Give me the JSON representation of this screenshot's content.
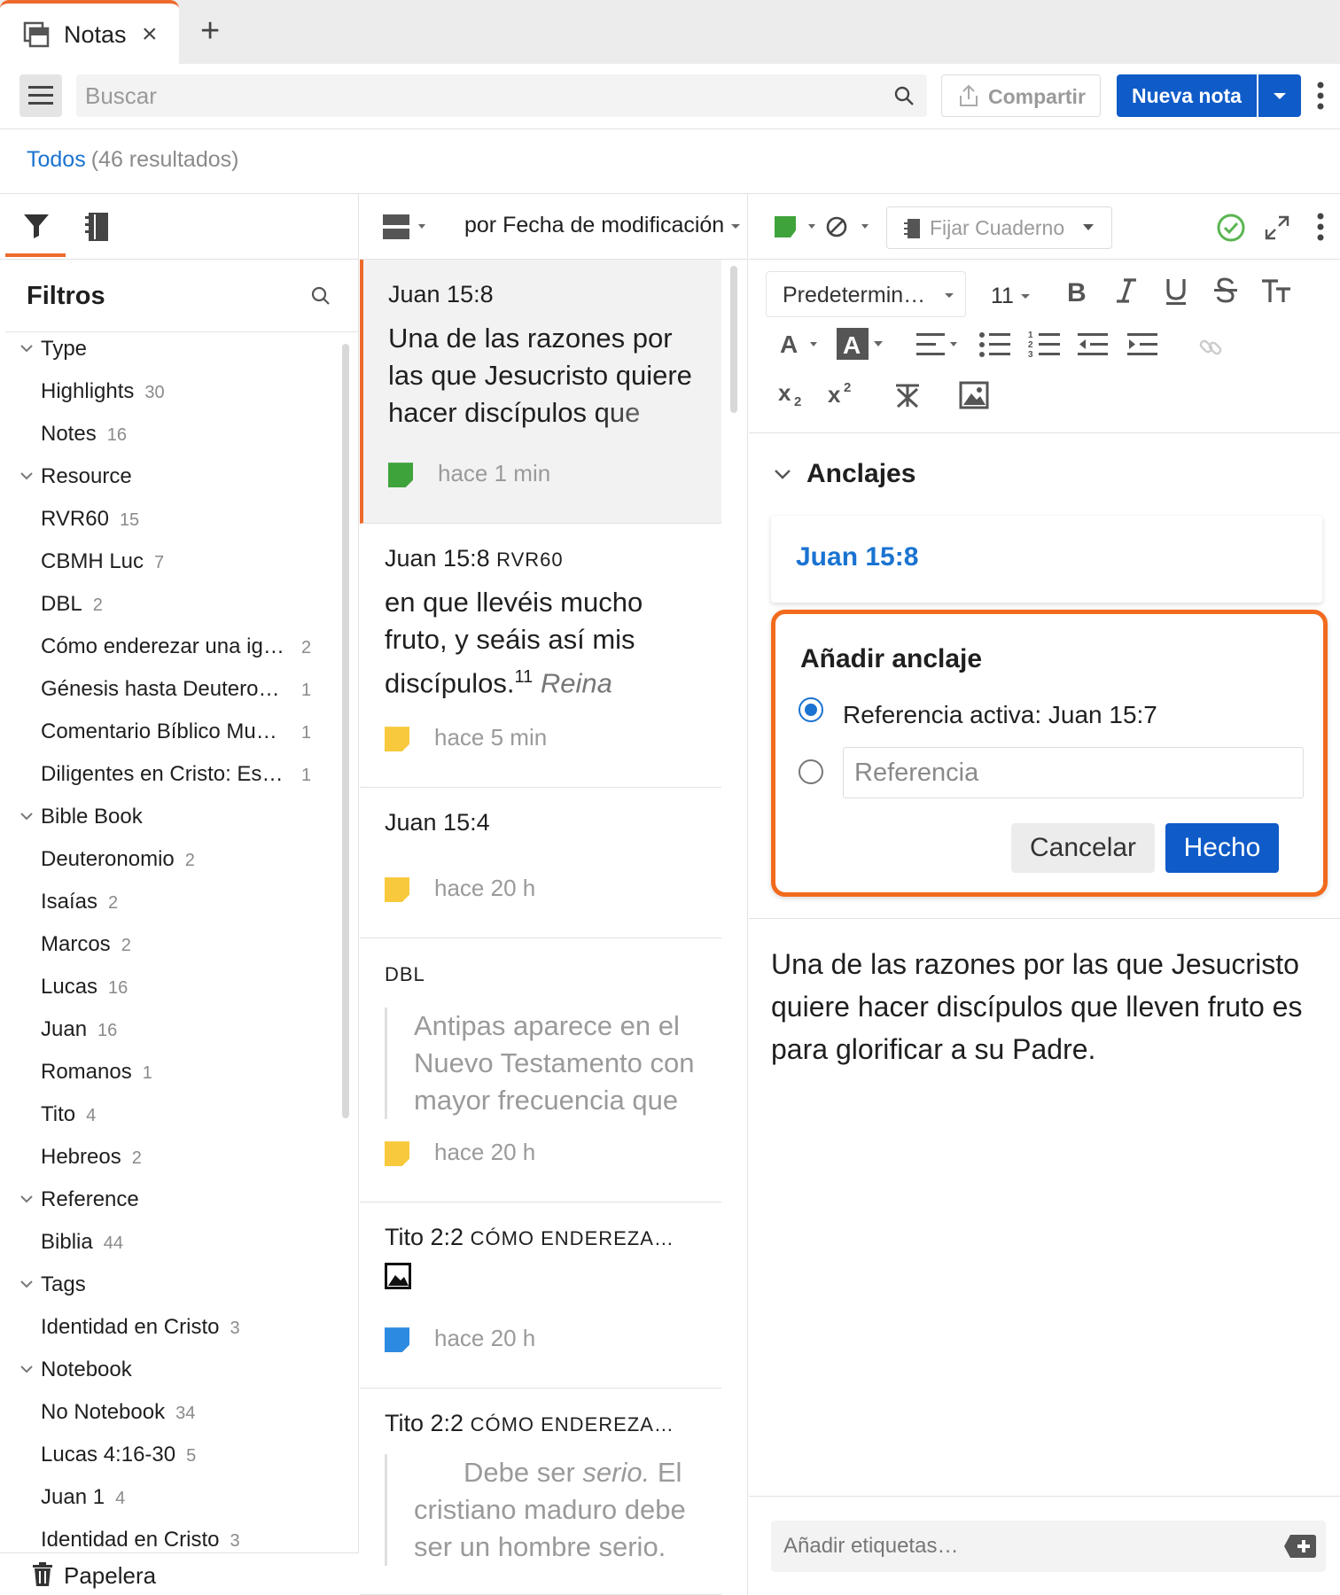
{
  "tab": {
    "title": "Notas",
    "close_icon": "×",
    "add_icon": "+"
  },
  "toolbar": {
    "search_placeholder": "Buscar",
    "share_label": "Compartir",
    "new_note_label": "Nueva nota"
  },
  "results": {
    "filter_label": "Todos",
    "count_label": "(46 resultados)"
  },
  "filters": {
    "title": "Filtros",
    "groups": [
      {
        "label": "Type",
        "items": [
          {
            "label": "Highlights",
            "count": "30"
          },
          {
            "label": "Notes",
            "count": "16"
          }
        ]
      },
      {
        "label": "Resource",
        "items": [
          {
            "label": "RVR60",
            "count": "15"
          },
          {
            "label": "CBMH Luc",
            "count": "7"
          },
          {
            "label": "DBL",
            "count": "2"
          },
          {
            "label": "Cómo enderezar una ig…",
            "count": "2"
          },
          {
            "label": "Génesis hasta Deutero…",
            "count": "1"
          },
          {
            "label": "Comentario Bíblico Mu…",
            "count": "1"
          },
          {
            "label": "Diligentes en Cristo: Est…",
            "count": "1"
          }
        ]
      },
      {
        "label": "Bible Book",
        "items": [
          {
            "label": "Deuteronomio",
            "count": "2"
          },
          {
            "label": "Isaías",
            "count": "2"
          },
          {
            "label": "Marcos",
            "count": "2"
          },
          {
            "label": "Lucas",
            "count": "16"
          },
          {
            "label": "Juan",
            "count": "16"
          },
          {
            "label": "Romanos",
            "count": "1"
          },
          {
            "label": "Tito",
            "count": "4"
          },
          {
            "label": "Hebreos",
            "count": "2"
          }
        ]
      },
      {
        "label": "Reference",
        "items": [
          {
            "label": "Biblia",
            "count": "44"
          }
        ]
      },
      {
        "label": "Tags",
        "items": [
          {
            "label": "Identidad en Cristo",
            "count": "3"
          }
        ]
      },
      {
        "label": "Notebook",
        "items": [
          {
            "label": "No Notebook",
            "count": "34"
          },
          {
            "label": "Lucas 4:16-30",
            "count": "5"
          },
          {
            "label": "Juan 1",
            "count": "4"
          },
          {
            "label": "Identidad en Cristo",
            "count": "3"
          }
        ]
      }
    ],
    "trash_label": "Papelera"
  },
  "list": {
    "sort_label": "por Fecha de modificación",
    "notes": [
      {
        "title": "Juan 15:8",
        "resource": "",
        "body": "Una de las razones por las que Jesucristo quiere hacer discípulos que",
        "quote": "",
        "time": "hace 1 min",
        "color": "#3fa33c"
      },
      {
        "title": "Juan 15:8",
        "resource": "RVR60",
        "body": "en que llevéis mucho fruto, y seáis así mis discípulos.",
        "sup": "11",
        "tail": " Reina",
        "quote": "",
        "time": "hace 5 min",
        "color": "#f8c93c"
      },
      {
        "title": "Juan 15:4",
        "resource": "",
        "body": "",
        "quote": "",
        "time": "hace 20 h",
        "color": "#f8c93c"
      },
      {
        "title": "",
        "resource": "DBL",
        "body": "",
        "quote": "Antipas aparece en el Nuevo Testamento con mayor frecuencia que",
        "time": "hace 20 h",
        "color": "#f8c93c"
      },
      {
        "title": "Tito 2:2",
        "resource": "CÓMO ENDEREZA…",
        "body": "",
        "quote": "",
        "time": "hace 20 h",
        "color": "#2c8be0"
      },
      {
        "title": "Tito 2:2",
        "resource": "CÓMO ENDEREZA…",
        "body": "",
        "quote_prefix": "Debe ser ",
        "quote_em": "serio.",
        "quote": " El cristiano maduro debe ser un hombre serio.",
        "time": "",
        "color": ""
      }
    ]
  },
  "editor": {
    "notebook_placeholder": "Fijar Cuaderno",
    "font_label": "Predetermin…",
    "size_label": "11",
    "anchors_title": "Anclajes",
    "anchor_link": "Juan 15:8",
    "add_anchor": {
      "title": "Añadir anclaje",
      "active_label": "Referencia activa: Juan 15:7",
      "ref_placeholder": "Referencia",
      "cancel_label": "Cancelar",
      "done_label": "Hecho"
    },
    "note_text": "Una de las razones por las que Jesucristo quiere hacer discípulos que lleven fruto es para glorificar a su Padre.",
    "tags_placeholder": "Añadir etiquetas…"
  },
  "colors": {
    "accent": "#ee6a2c",
    "primary": "#0f5bc8",
    "link": "#1a73d1"
  }
}
